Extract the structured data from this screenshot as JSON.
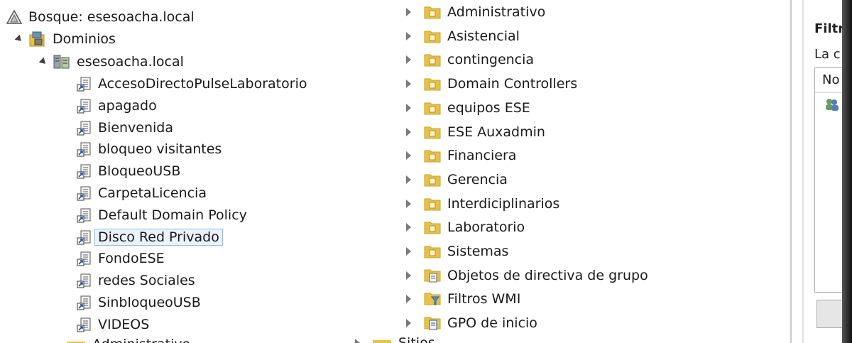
{
  "left_tree": {
    "top_partial": "…",
    "forest_label": "Bosque: esesoacha.local",
    "domains_label": "Dominios",
    "domain_label": "esesoacha.local",
    "gpo_links": [
      "AccesoDirectoPulseLaboratorio",
      "apagado",
      "Bienvenida",
      "bloqueo visitantes",
      "BloqueoUSB",
      "CarpetaLicencia",
      "Default Domain Policy",
      "Disco Red Privado",
      "FondoESE",
      "redes Sociales",
      "SinbloqueoUSB",
      "VIDEOS"
    ],
    "selected": "Disco Red Privado",
    "bottom_partial": "Administrativo"
  },
  "middle_tree": {
    "ou_items": [
      "Administrativo",
      "Asistencial",
      "contingencia",
      "Domain Controllers",
      "equipos ESE",
      "ESE Auxadmin",
      "Financiera",
      "Gerencia",
      "Interdiciplinarios",
      "Laboratorio",
      "Sistemas"
    ],
    "special_items": [
      {
        "label": "Objetos de directiva de grupo",
        "icon": "gpo-container-icon"
      },
      {
        "label": "Filtros WMI",
        "icon": "wmi-filter-icon"
      },
      {
        "label": "GPO de inicio",
        "icon": "starter-gpo-icon"
      }
    ],
    "bottom_partial": "Sitios"
  },
  "right_panel": {
    "heading_partial": "Filtr",
    "text_partial": "La c",
    "column_partial": "No"
  },
  "colors": {
    "folder": "#e8c247",
    "folder_dark": "#c9a12c",
    "selection_border": "#9bb8d9",
    "selection_fill": "#eaf2fb"
  }
}
